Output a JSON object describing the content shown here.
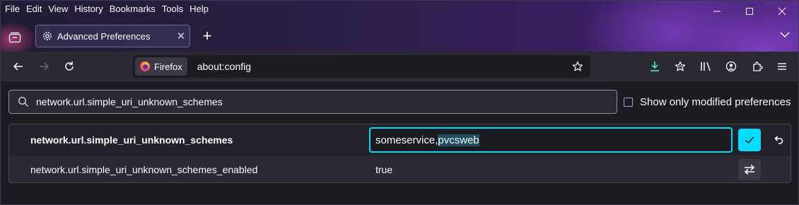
{
  "window": {
    "menu": [
      "File",
      "Edit",
      "View",
      "History",
      "Bookmarks",
      "Tools",
      "Help"
    ],
    "controls": {
      "minimize": "—",
      "maximize": "☐",
      "close": "✕"
    }
  },
  "tabs": [
    {
      "title": "Advanced Preferences",
      "close": "✕"
    }
  ],
  "new_tab": "+",
  "navbar": {
    "identity_label": "Firefox",
    "url": "about:config"
  },
  "config": {
    "search_value": "network.url.simple_uri_unknown_schemes",
    "show_modified_label": "Show only modified preferences",
    "rows": [
      {
        "name": "network.url.simple_uri_unknown_schemes",
        "value_part1": "someservice,",
        "value_part2": "pvcsweb",
        "editing": true
      },
      {
        "name": "network.url.simple_uri_unknown_schemes_enabled",
        "value": "true"
      }
    ]
  },
  "colors": {
    "accent": "#00ddff",
    "bg": "#1c1b22",
    "toolbar": "#2b2a33"
  }
}
